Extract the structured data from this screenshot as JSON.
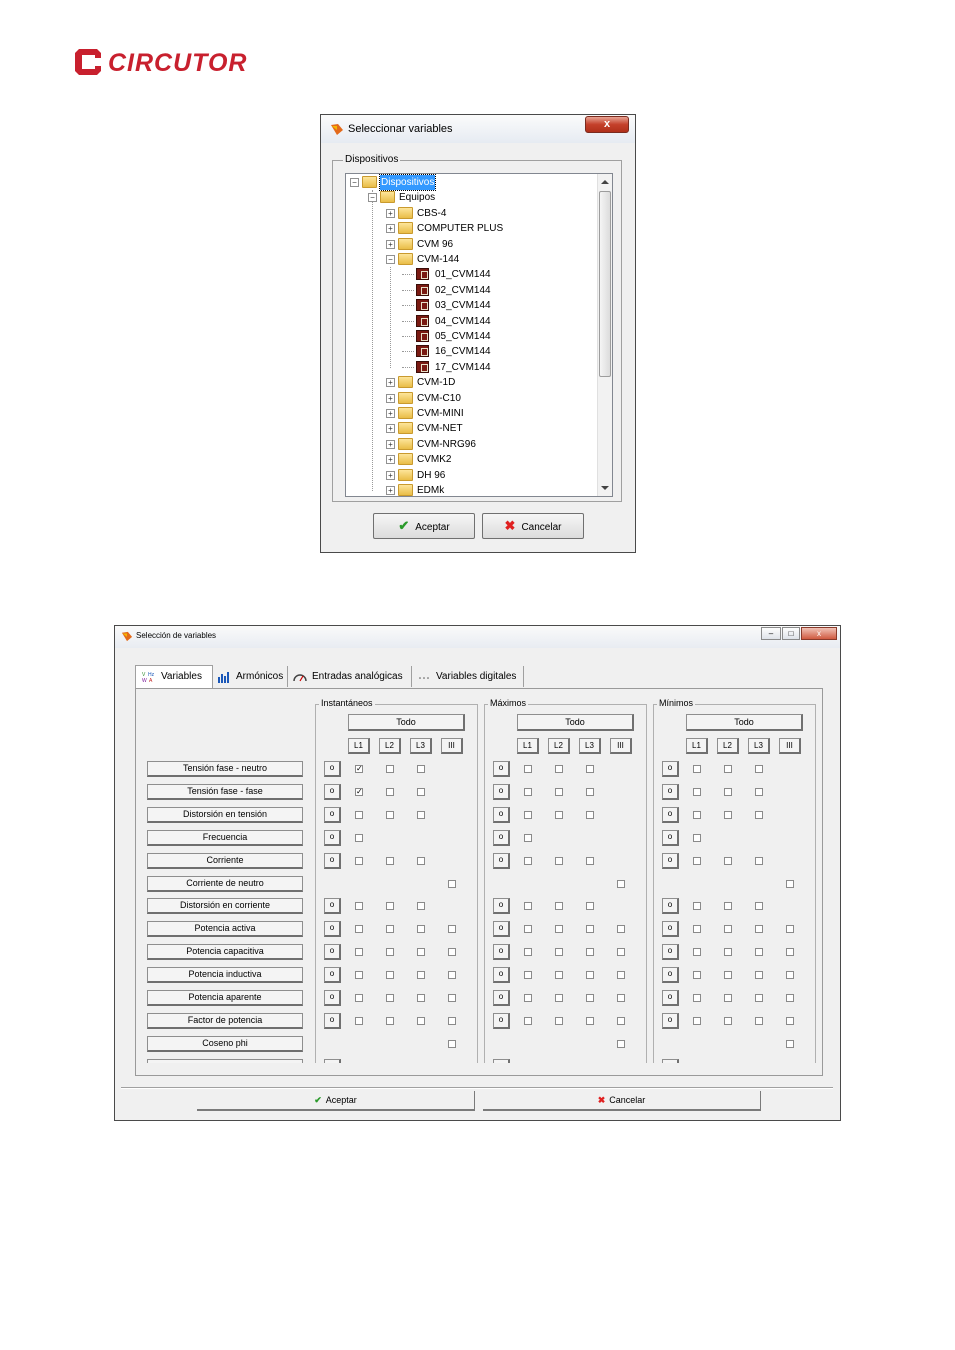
{
  "logo": {
    "brand": "CIRCUTOR",
    "color": "#c8202e"
  },
  "dialog1": {
    "title": "Seleccionar variables",
    "close_label": "x",
    "group_label": "Dispositivos",
    "tree": [
      {
        "label": "Dispositivos",
        "level": 0,
        "expander": "−",
        "icon": "folder-icon",
        "selected": true
      },
      {
        "label": "Equipos",
        "level": 1,
        "expander": "−",
        "icon": "folder-icon"
      },
      {
        "label": "CBS-4",
        "level": 2,
        "expander": "+",
        "icon": "folder-icon"
      },
      {
        "label": "COMPUTER PLUS",
        "level": 2,
        "expander": "+",
        "icon": "folder-icon"
      },
      {
        "label": "CVM 96",
        "level": 2,
        "expander": "+",
        "icon": "folder-icon"
      },
      {
        "label": "CVM-144",
        "level": 2,
        "expander": "−",
        "icon": "folder-icon"
      },
      {
        "label": "01_CVM144",
        "level": 3,
        "icon": "device-icon"
      },
      {
        "label": "02_CVM144",
        "level": 3,
        "icon": "device-icon"
      },
      {
        "label": "03_CVM144",
        "level": 3,
        "icon": "device-icon"
      },
      {
        "label": "04_CVM144",
        "level": 3,
        "icon": "device-icon"
      },
      {
        "label": "05_CVM144",
        "level": 3,
        "icon": "device-icon"
      },
      {
        "label": "16_CVM144",
        "level": 3,
        "icon": "device-icon"
      },
      {
        "label": "17_CVM144",
        "level": 3,
        "icon": "device-icon"
      },
      {
        "label": "CVM-1D",
        "level": 2,
        "expander": "+",
        "icon": "folder-icon"
      },
      {
        "label": "CVM-C10",
        "level": 2,
        "expander": "+",
        "icon": "folder-icon"
      },
      {
        "label": "CVM-MINI",
        "level": 2,
        "expander": "+",
        "icon": "folder-icon"
      },
      {
        "label": "CVM-NET",
        "level": 2,
        "expander": "+",
        "icon": "folder-icon"
      },
      {
        "label": "CVM-NRG96",
        "level": 2,
        "expander": "+",
        "icon": "folder-icon"
      },
      {
        "label": "CVMK2",
        "level": 2,
        "expander": "+",
        "icon": "folder-icon"
      },
      {
        "label": "DH 96",
        "level": 2,
        "expander": "+",
        "icon": "folder-icon"
      },
      {
        "label": "EDMk",
        "level": 2,
        "expander": "+",
        "icon": "folder-icon"
      }
    ],
    "ok_label": "Aceptar",
    "cancel_label": "Cancelar"
  },
  "dialog2": {
    "title": "Selección de variables",
    "controls": {
      "minimize": "–",
      "maximize": "□",
      "close": "x"
    },
    "tabs": [
      {
        "label": "Variables",
        "icon": "variables-icon",
        "active": true
      },
      {
        "label": "Armónicos",
        "icon": "bar-chart-icon"
      },
      {
        "label": "Entradas analógicas",
        "icon": "gauge-icon"
      },
      {
        "label": "Variables digitales",
        "icon": "digital-icon"
      }
    ],
    "groups": [
      {
        "label": "Instantáneos",
        "todo_label": "Todo",
        "phase_labels": [
          "L1",
          "L2",
          "L3",
          "III"
        ]
      },
      {
        "label": "Máximos",
        "todo_label": "Todo",
        "phase_labels": [
          "L1",
          "L2",
          "L3",
          "III"
        ]
      },
      {
        "label": "Mínimos",
        "todo_label": "Todo",
        "phase_labels": [
          "L1",
          "L2",
          "L3",
          "III"
        ]
      }
    ],
    "row_button_glyph": "o",
    "check_mark": "✓",
    "rows": [
      {
        "label": "Tensión fase - neutro",
        "sq": true,
        "cb": [
          1,
          1,
          1,
          0
        ],
        "checked_inst": [
          true,
          false,
          false,
          false
        ]
      },
      {
        "label": "Tensión fase - fase",
        "sq": true,
        "cb": [
          1,
          1,
          1,
          0
        ],
        "checked_inst": [
          true,
          false,
          false,
          false
        ]
      },
      {
        "label": "Distorsión en tensión",
        "sq": true,
        "cb": [
          1,
          1,
          1,
          0
        ],
        "checked_inst": [
          false,
          false,
          false,
          false
        ]
      },
      {
        "label": "Frecuencia",
        "sq": true,
        "cb": [
          1,
          0,
          0,
          0
        ],
        "checked_inst": [
          false,
          false,
          false,
          false
        ]
      },
      {
        "label": "Corriente",
        "sq": true,
        "cb": [
          1,
          1,
          1,
          0
        ],
        "checked_inst": [
          false,
          false,
          false,
          false
        ]
      },
      {
        "label": "Corriente de neutro",
        "sq": false,
        "cb": [
          0,
          0,
          0,
          1
        ],
        "checked_inst": [
          false,
          false,
          false,
          false
        ]
      },
      {
        "label": "Distorsión en corriente",
        "sq": true,
        "cb": [
          1,
          1,
          1,
          0
        ],
        "checked_inst": [
          false,
          false,
          false,
          false
        ]
      },
      {
        "label": "Potencia activa",
        "sq": true,
        "cb": [
          1,
          1,
          1,
          1
        ],
        "checked_inst": [
          false,
          false,
          false,
          false
        ]
      },
      {
        "label": "Potencia capacitiva",
        "sq": true,
        "cb": [
          1,
          1,
          1,
          1
        ],
        "checked_inst": [
          false,
          false,
          false,
          false
        ]
      },
      {
        "label": "Potencia inductiva",
        "sq": true,
        "cb": [
          1,
          1,
          1,
          1
        ],
        "checked_inst": [
          false,
          false,
          false,
          false
        ]
      },
      {
        "label": "Potencia aparente",
        "sq": true,
        "cb": [
          1,
          1,
          1,
          1
        ],
        "checked_inst": [
          false,
          false,
          false,
          false
        ]
      },
      {
        "label": "Factor de potencia",
        "sq": true,
        "cb": [
          1,
          1,
          1,
          1
        ],
        "checked_inst": [
          false,
          false,
          false,
          false
        ]
      },
      {
        "label": "Coseno phi",
        "sq": false,
        "cb": [
          0,
          0,
          0,
          1
        ],
        "checked_inst": [
          false,
          false,
          false,
          false
        ]
      }
    ],
    "ok_label": "Aceptar",
    "cancel_label": "Cancelar"
  }
}
